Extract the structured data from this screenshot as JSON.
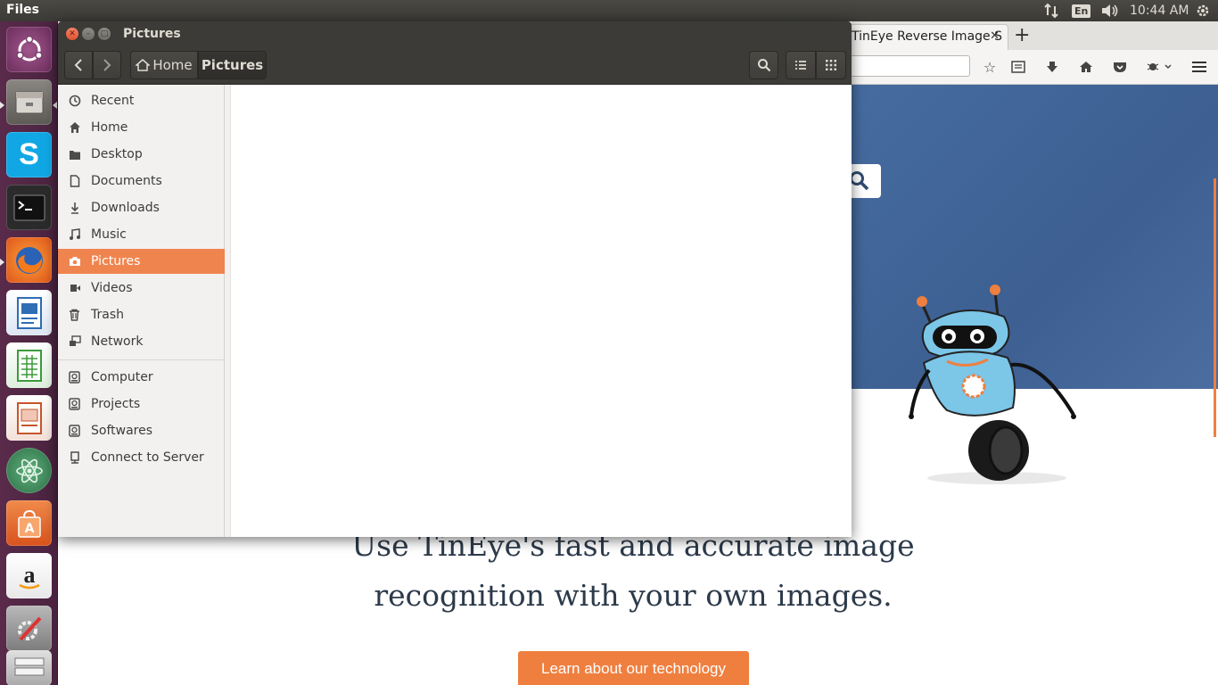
{
  "top_panel": {
    "app_title": "Files",
    "keyboard_layout": "En",
    "clock": "10:44 AM",
    "icons": [
      "network-icon",
      "keyboard-layout-indicator",
      "volume-icon",
      "system-gear-icon"
    ]
  },
  "launcher": {
    "items": [
      {
        "name": "ubuntu-dash",
        "color": "#7a3f6c"
      },
      {
        "name": "files",
        "color": "#6d6a66"
      },
      {
        "name": "skype",
        "color": "#11a7e5"
      },
      {
        "name": "terminal",
        "color": "#2e2e2e"
      },
      {
        "name": "firefox",
        "color": "#e66a1d"
      },
      {
        "name": "libreoffice-writer",
        "color": "#2f6db5"
      },
      {
        "name": "libreoffice-calc",
        "color": "#3c9b3c"
      },
      {
        "name": "libreoffice-impress",
        "color": "#c8552a"
      },
      {
        "name": "atom",
        "color": "#3d8c5a"
      },
      {
        "name": "ubuntu-software",
        "color": "#e0662a"
      },
      {
        "name": "amazon",
        "color": "#f2f2f2"
      },
      {
        "name": "system-settings",
        "color": "#8a8a8a"
      },
      {
        "name": "workspaces",
        "color": "#bdbdbd"
      }
    ]
  },
  "firefox": {
    "tab_title": "TinEye Reverse Image S",
    "page": {
      "headline_line1": "Use TinEye's fast and accurate image",
      "headline_line2": "recognition with your own images.",
      "cta_label": "Learn about our technology"
    },
    "colors": {
      "hero": "#466ca0",
      "accent": "#ef7f3f"
    }
  },
  "nautilus": {
    "window_title": "Pictures",
    "breadcrumbs": [
      {
        "label": "Home",
        "icon": "home-icon"
      },
      {
        "label": "Pictures"
      }
    ],
    "sidebar": {
      "places": [
        {
          "label": "Recent",
          "icon": "clock-icon"
        },
        {
          "label": "Home",
          "icon": "home-icon"
        },
        {
          "label": "Desktop",
          "icon": "folder-icon"
        },
        {
          "label": "Documents",
          "icon": "document-icon"
        },
        {
          "label": "Downloads",
          "icon": "download-icon"
        },
        {
          "label": "Music",
          "icon": "music-icon"
        },
        {
          "label": "Pictures",
          "icon": "camera-icon",
          "active": true
        },
        {
          "label": "Videos",
          "icon": "video-icon"
        },
        {
          "label": "Trash",
          "icon": "trash-icon"
        },
        {
          "label": "Network",
          "icon": "network-icon"
        }
      ],
      "devices": [
        {
          "label": "Computer",
          "icon": "drive-icon"
        },
        {
          "label": "Projects",
          "icon": "drive-icon"
        },
        {
          "label": "Softwares",
          "icon": "drive-icon"
        },
        {
          "label": "Connect to Server",
          "icon": "server-icon"
        }
      ]
    },
    "colors": {
      "selection": "#f0844f",
      "titlebar": "#3c3b37"
    }
  }
}
